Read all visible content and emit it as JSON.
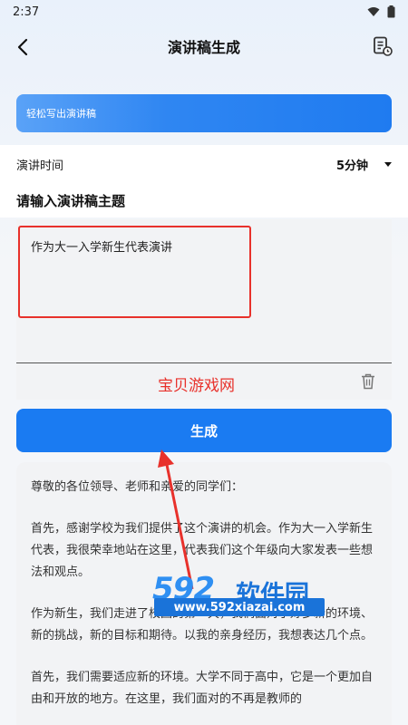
{
  "status_bar": {
    "time": "2:37"
  },
  "nav": {
    "title": "演讲稿生成"
  },
  "banner": {
    "text": "轻松写出演讲稿"
  },
  "time_setting": {
    "label": "演讲时间",
    "value": "5分钟"
  },
  "topic": {
    "heading": "请输入演讲稿主题",
    "value": "作为大一入学新生代表演讲"
  },
  "watermark": {
    "text": "宝贝游戏网"
  },
  "generate_button": {
    "label": "生成"
  },
  "result": {
    "paragraphs": [
      "尊敬的各位领导、老师和亲爱的同学们：",
      "首先，感谢学校为我们提供了这个演讲的机会。作为大一入学新生代表，我很荣幸地站在这里，代表我们这个年级向大家发表一些想法和观点。",
      "作为新生，我们走进了校园的第一天，我们面对了好多新的环境、新的挑战，新的目标和期待。以我的亲身经历，我想表达几个点。",
      "首先，我们需要适应新的环境。大学不同于高中，它是一个更加自由和开放的地方。在这里，我们面对的不再是教师的"
    ]
  },
  "site_logo": {
    "number": "592",
    "name": "软件园",
    "url": "www.592xiazai.com"
  },
  "colors": {
    "accent": "#1a7bf2",
    "highlight_red": "#e8312b"
  }
}
